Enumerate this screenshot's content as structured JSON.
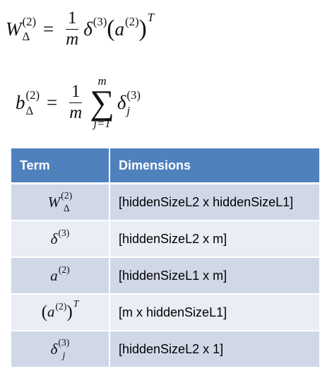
{
  "equations": {
    "eq1": {
      "lhs_symbol": "W",
      "lhs_superscript": "(2)",
      "lhs_subscript": "Δ",
      "equals": "=",
      "frac_num": "1",
      "frac_den": "m",
      "delta": "δ",
      "delta_superscript": "(3)",
      "open_paren": "(",
      "a": "a",
      "a_superscript": "(2)",
      "close_paren": ")",
      "transpose": "T"
    },
    "eq2": {
      "lhs_symbol": "b",
      "lhs_superscript": "(2)",
      "lhs_subscript": "Δ",
      "equals": "=",
      "frac_num": "1",
      "frac_den": "m",
      "sum_upper": "m",
      "sum_symbol": "∑",
      "sum_lower": "j=1",
      "delta": "δ",
      "delta_superscript": "(3)",
      "delta_subscript": "j"
    }
  },
  "table": {
    "headers": {
      "term": "Term",
      "dimensions": "Dimensions"
    },
    "rows": [
      {
        "dimensions": "[hiddenSizeL2 x hiddenSizeL1]"
      },
      {
        "dimensions": "[hiddenSizeL2 x m]"
      },
      {
        "dimensions": "[hiddenSizeL1 x m]"
      },
      {
        "dimensions": "[m x hiddenSizeL1]"
      },
      {
        "dimensions": "[hiddenSizeL2 x 1]"
      }
    ],
    "terms": {
      "r1": {
        "symbol": "W",
        "sup": "(2)",
        "sub": "Δ"
      },
      "r2": {
        "symbol": "δ",
        "sup": "(3)"
      },
      "r3": {
        "symbol": "a",
        "sup": "(2)"
      },
      "r4": {
        "open": "(",
        "symbol": "a",
        "sup": "(2)",
        "close": ")",
        "transpose": "T"
      },
      "r5": {
        "symbol": "δ",
        "sup": "(3)",
        "sub": "j"
      }
    },
    "colors": {
      "header_bg": "#4f81bd",
      "row_odd_bg": "#d0d8e8",
      "row_even_bg": "#e9edf4"
    }
  }
}
